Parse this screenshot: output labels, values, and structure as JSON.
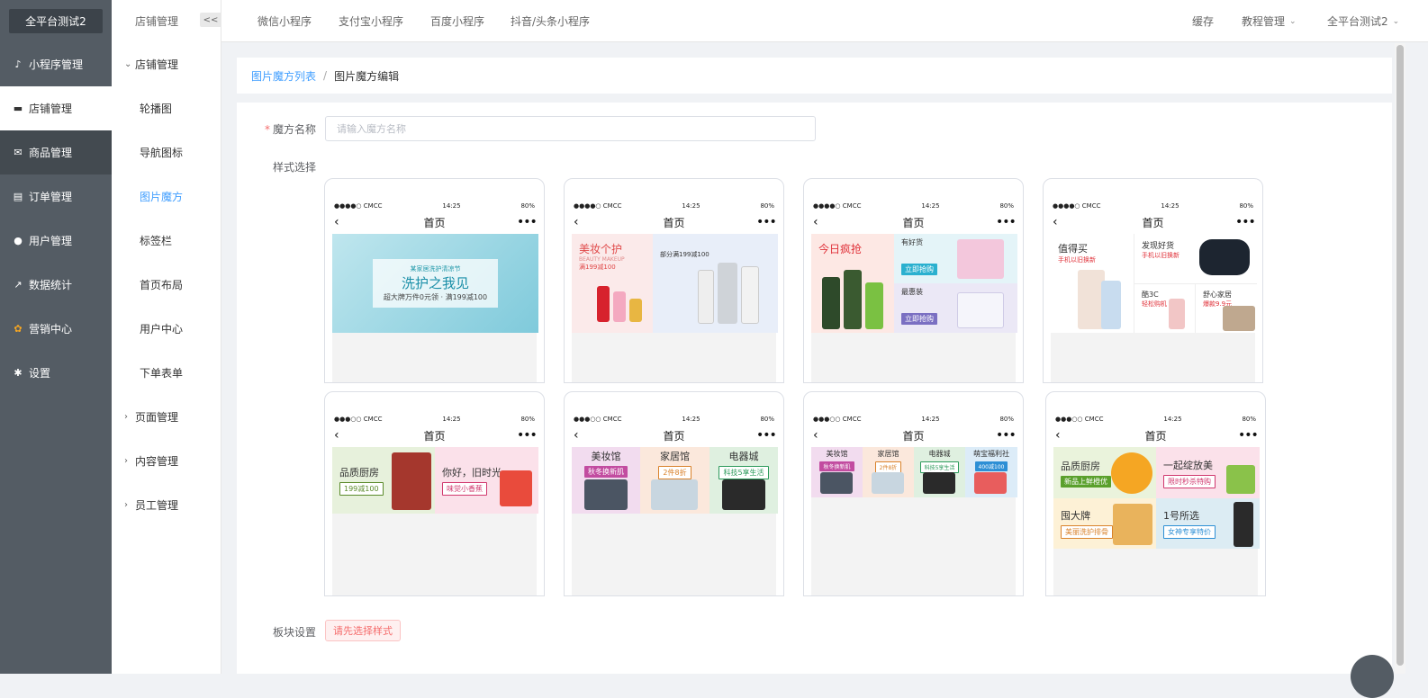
{
  "sidebar": {
    "brand": "全平台测试2",
    "items": [
      {
        "label": "小程序管理",
        "icon": "mini-program-icon"
      },
      {
        "label": "店铺管理",
        "icon": "shop-icon"
      },
      {
        "label": "商品管理",
        "icon": "goods-icon"
      },
      {
        "label": "订单管理",
        "icon": "order-icon"
      },
      {
        "label": "用户管理",
        "icon": "user-icon"
      },
      {
        "label": "数据统计",
        "icon": "chart-icon"
      },
      {
        "label": "营销中心",
        "icon": "marketing-icon"
      },
      {
        "label": "设置",
        "icon": "gear-icon"
      }
    ]
  },
  "submenu": {
    "title": "店铺管理",
    "collapse": "<<",
    "group1": "店铺管理",
    "items": [
      "轮播图",
      "导航图标",
      "图片魔方",
      "标签栏",
      "首页布局",
      "用户中心",
      "下单表单"
    ],
    "group2": "页面管理",
    "group3": "内容管理",
    "group4": "员工管理"
  },
  "topnav": {
    "tabs": [
      "微信小程序",
      "支付宝小程序",
      "百度小程序",
      "抖音/头条小程序"
    ],
    "cache": "缓存",
    "tutorial": "教程管理",
    "account": "全平台测试2"
  },
  "breadcrumb": {
    "list": "图片魔方列表",
    "sep": "/",
    "current": "图片魔方编辑"
  },
  "form": {
    "name_label": "魔方名称",
    "name_placeholder": "请输入魔方名称",
    "style_label": "样式选择",
    "block_label": "板块设置",
    "block_button": "请先选择样式"
  },
  "phone": {
    "carrier_a": "●●●○○ CMCC",
    "carrier_b": "●●●●○ CMCC",
    "time": "14:25",
    "battery": "80%",
    "title": "首页",
    "back": "‹",
    "more": "•••"
  },
  "templates": {
    "t1": {
      "headline": "洗护之我见",
      "sub": "超大牌万件0元领 · 满199减100",
      "top": "某家居洗护清凉节"
    },
    "t2": {
      "title": "美妆个护",
      "en": "BEAUTY MAKEUP",
      "deal": "满199减100",
      "right": "部分满199减100"
    },
    "t3": {
      "left": "今日疯抢",
      "r1": "有好货",
      "r1tag": "立即抢购",
      "r2": "最惠装",
      "r2tag": "立即抢购"
    },
    "t4": {
      "c1": "值得买",
      "c1s": "手机以旧换新",
      "c2": "发现好货",
      "c2s": "手机以旧换新",
      "c3": "酷3C",
      "c3s": "轻松购机",
      "c4": "舒心家居",
      "c4s": "爆款9.9元"
    },
    "t5": {
      "l": "品质厨房",
      "ltag": "199减100",
      "r": "你好，旧时光",
      "rtag": "味觉小香蕉"
    },
    "t6": {
      "a": "美妆馆",
      "atag": "秋冬换新肌",
      "b": "家居馆",
      "btag": "2件8折",
      "c": "电器城",
      "ctag": "科技5享生活"
    },
    "t7": {
      "a": "美妆馆",
      "atag": "秋冬换新肌",
      "b": "家居馆",
      "btag": "2件8折",
      "c": "电器城",
      "ctag": "科技5享生活",
      "d": "萌宝福利社",
      "dtag": "400减100"
    },
    "t8": {
      "a": "品质厨房",
      "atag": "新品上鲜橙优",
      "b": "一起绽放美",
      "btag": "限时秒杀特购",
      "c": "囤大牌",
      "ctag": "美丽洗护排骨",
      "d": "1号所选",
      "dtag": "女神专享特价"
    }
  },
  "colors": {
    "sidebar": "#545c64",
    "accent": "#409eff",
    "danger": "#f56c6c"
  }
}
